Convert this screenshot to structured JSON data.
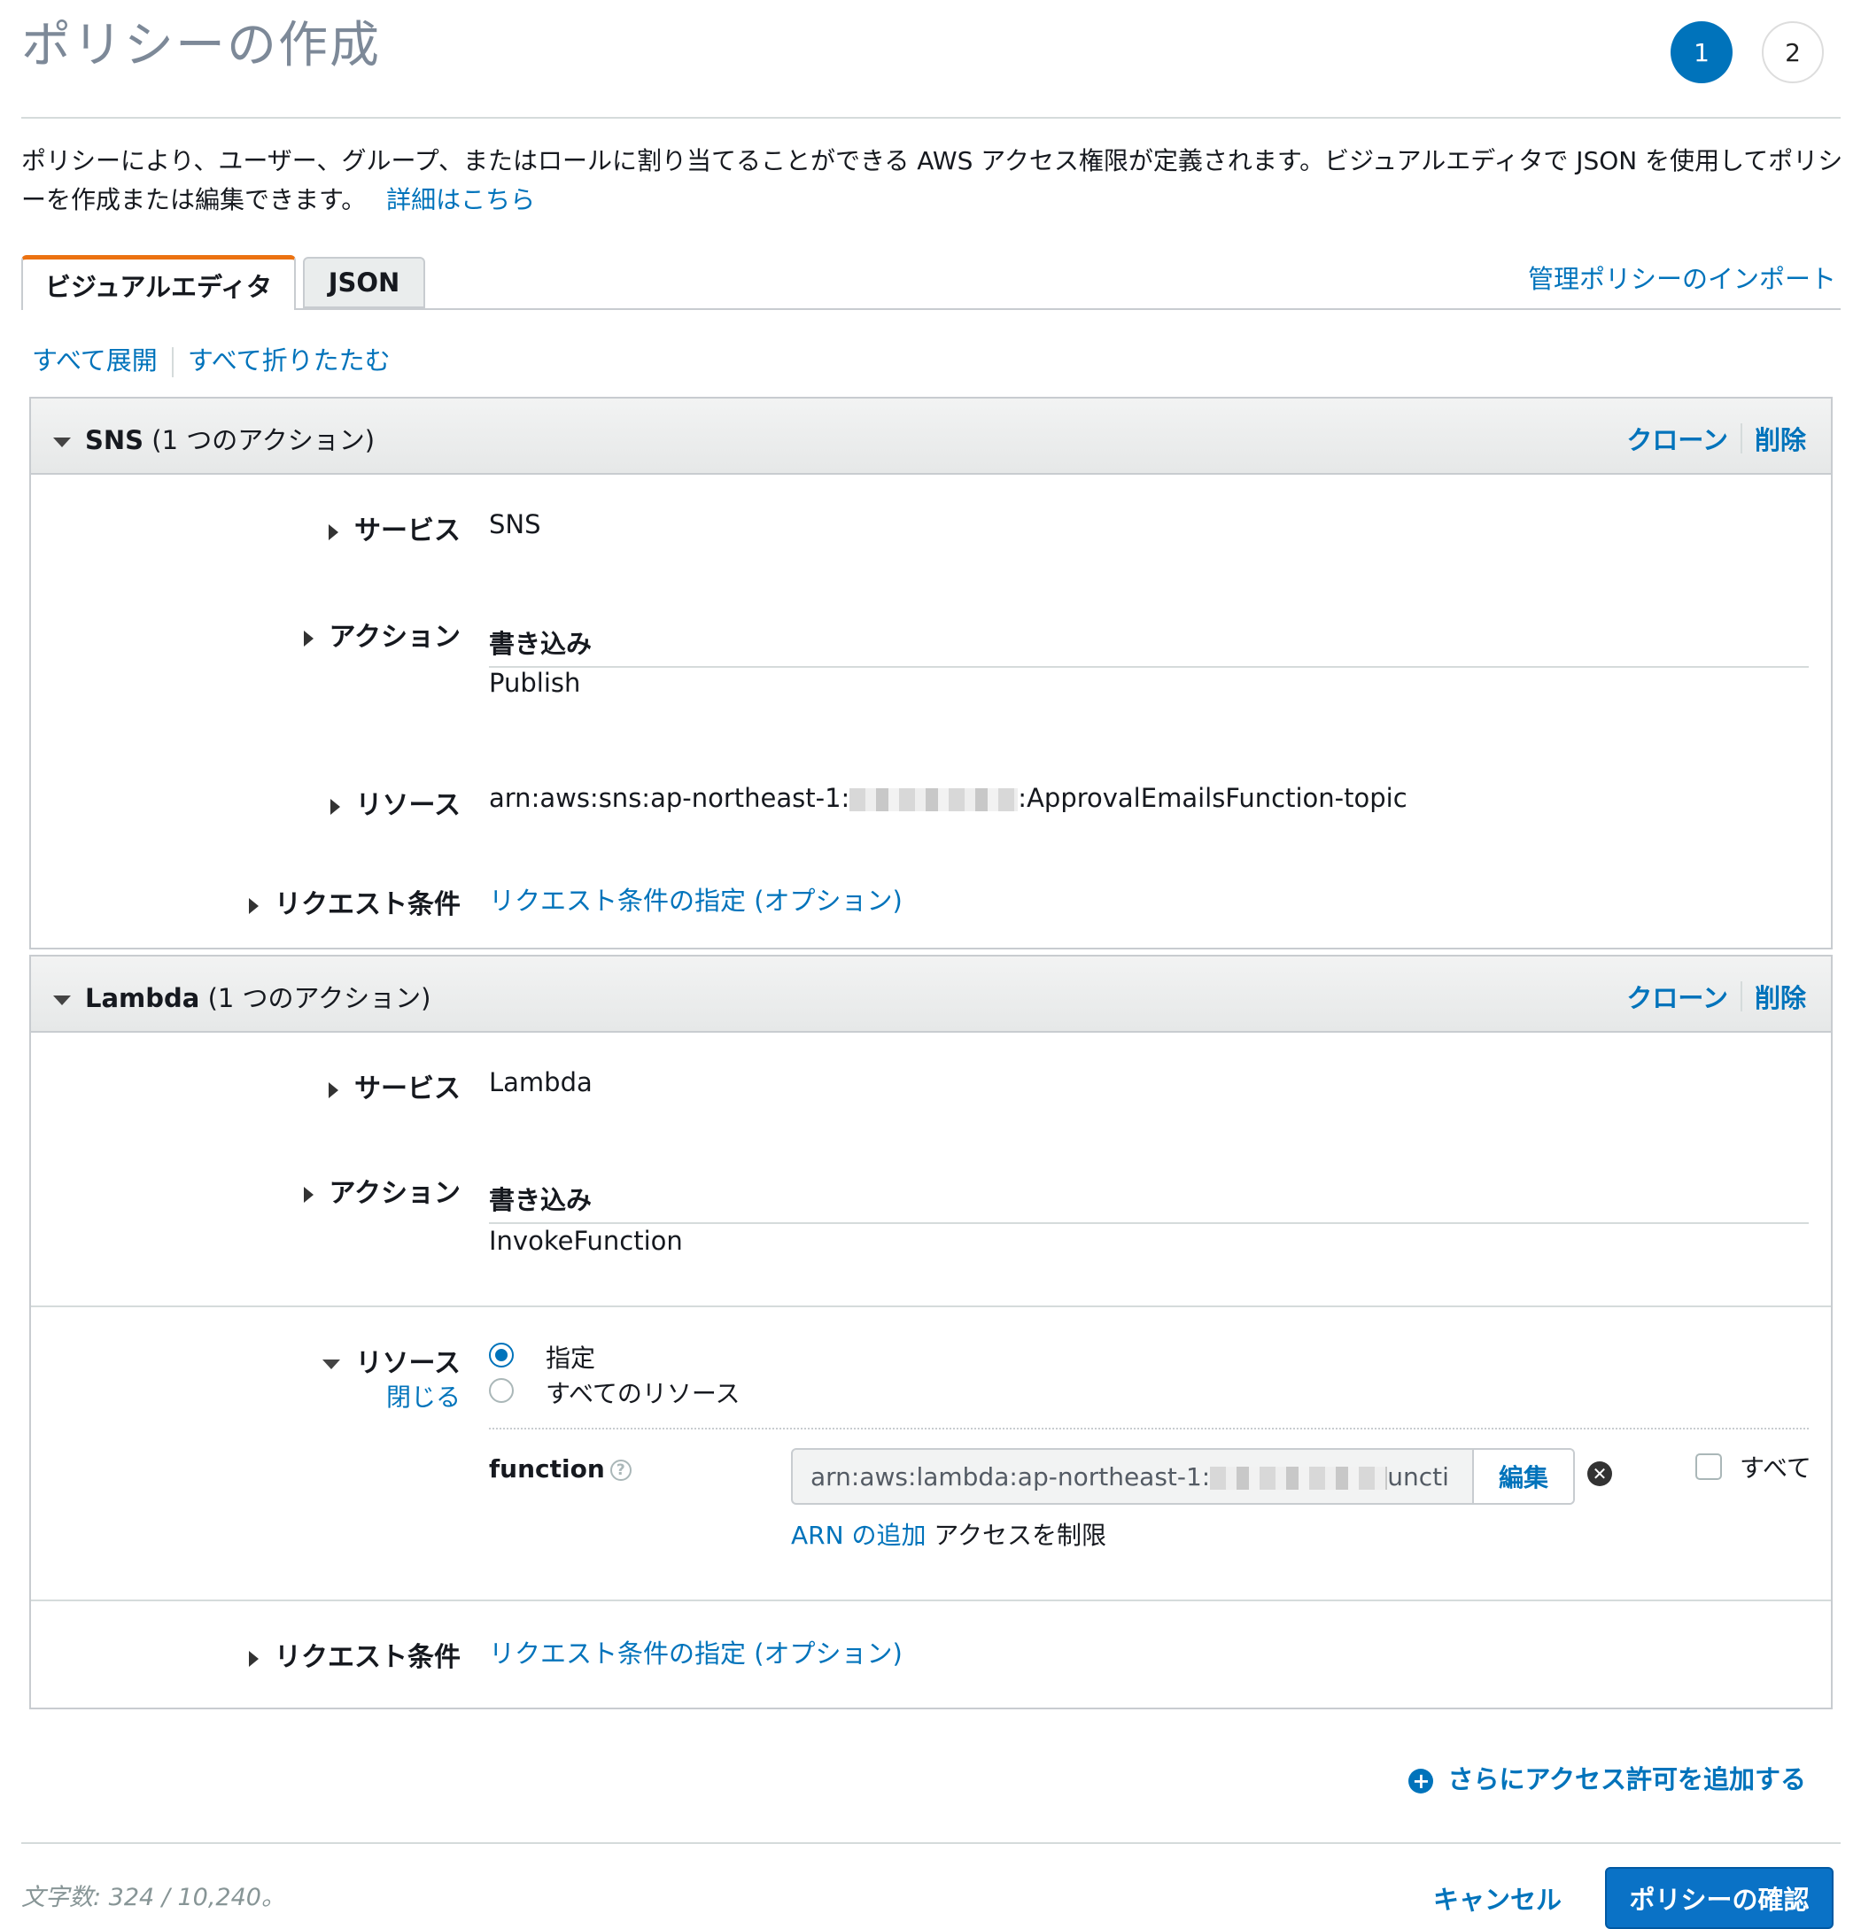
{
  "page": {
    "title": "ポリシーの作成",
    "steps": [
      "1",
      "2"
    ]
  },
  "intro": {
    "text": "ポリシーにより、ユーザー、グループ、またはロールに割り当てることができる AWS アクセス権限が定義されます。ビジュアルエディタで JSON を使用してポリシーを作成または編集できます。",
    "learn_more": "詳細はこちら"
  },
  "tabs": [
    {
      "label": "ビジュアルエディタ",
      "active": true
    },
    {
      "label": "JSON",
      "active": false
    }
  ],
  "import_link": "管理ポリシーのインポート",
  "expand_all": "すべて展開",
  "collapse_all": "すべて折りたたむ",
  "labels": {
    "service": "サービス",
    "actions": "アクション",
    "resources": "リソース",
    "request_conditions": "リクエスト条件",
    "clone": "クローン",
    "delete": "削除",
    "close": "閉じる",
    "write": "書き込み",
    "conditions_link": "リクエスト条件の指定 (オプション)"
  },
  "sns": {
    "name": "SNS",
    "count": "(1 つのアクション)",
    "service": "SNS",
    "action": "Publish",
    "resource_prefix": "arn:aws:sns:ap-northeast-1:",
    "resource_suffix": ":ApprovalEmailsFunction-topic"
  },
  "lambda": {
    "name": "Lambda",
    "count": "(1 つのアクション)",
    "service": "Lambda",
    "action": "InvokeFunction",
    "radio_specific": "指定",
    "radio_all": "すべてのリソース",
    "function_label": "function",
    "arn_prefix": "arn:aws:lambda:ap-northeast-1:",
    "arn_suffix": "unction:se",
    "edit": "編集",
    "all_label": "すべて",
    "add_arn": "ARN の追加",
    "restrict": "アクセスを制限"
  },
  "add_permissions": "さらにアクセス許可を追加する",
  "footer": {
    "char_count": "文字数: 324 / 10,240。",
    "cancel": "キャンセル",
    "review": "ポリシーの確認"
  },
  "colors": {
    "accent": "#0073bb",
    "tab_active": "#ec7211",
    "primary_button": "#0a72c6"
  }
}
